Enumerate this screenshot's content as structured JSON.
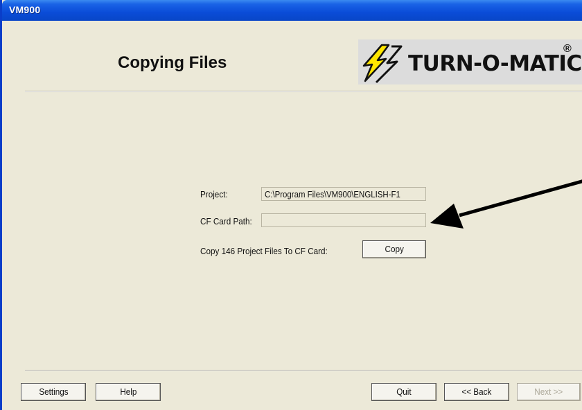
{
  "window": {
    "title": "VM900"
  },
  "header": {
    "title": "Copying Files",
    "logo_text": "TURN-O-MATIC",
    "logo_reg": "®"
  },
  "form": {
    "project_label": "Project:",
    "project_value": "C:\\Program Files\\VM900\\ENGLISH-F1",
    "cf_label": "CF Card Path:",
    "cf_value": "",
    "copy_label": "Copy 146 Project Files To CF Card:",
    "copy_button": "Copy"
  },
  "footer": {
    "settings": "Settings",
    "help": "Help",
    "quit": "Quit",
    "back": "<< Back",
    "next": "Next >>"
  },
  "colors": {
    "titlebar": "#0a4cd8",
    "background": "#ece9d8",
    "logo_bolt": "#ffe600"
  }
}
